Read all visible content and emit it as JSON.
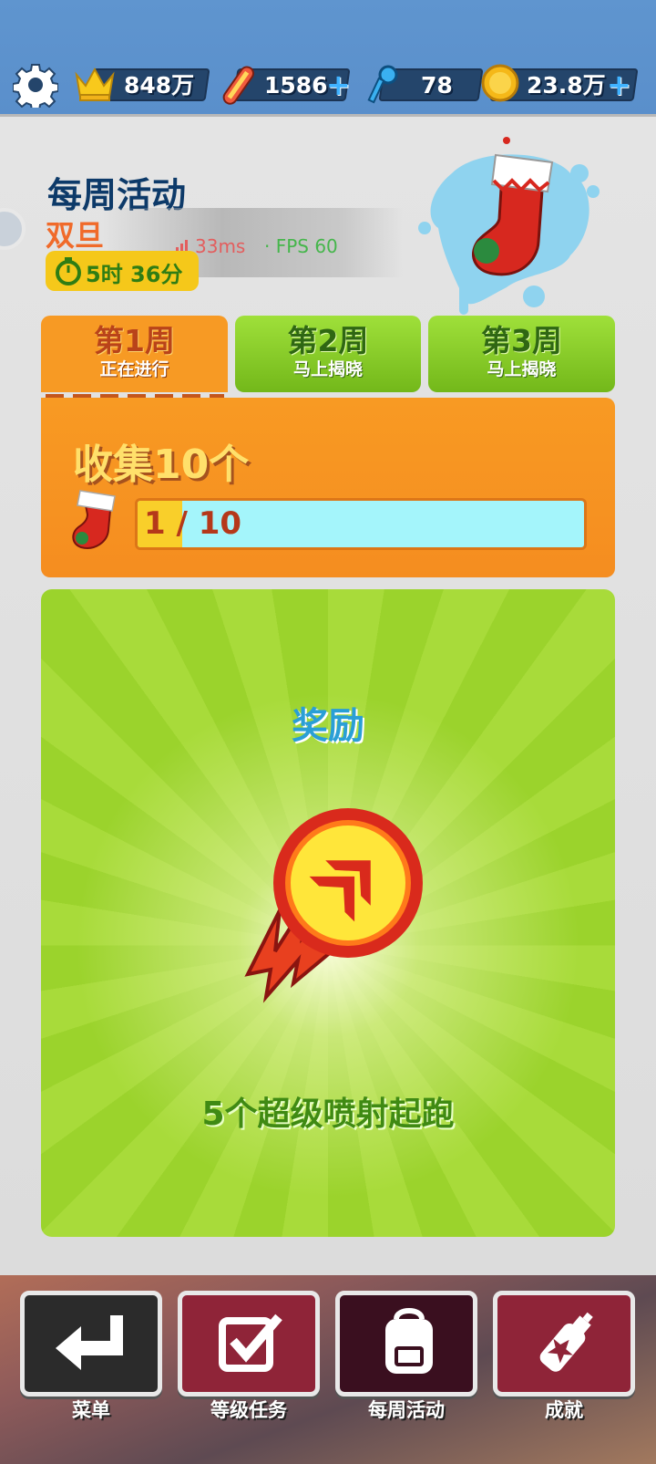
{
  "topbar": {
    "settings_icon": "gear-icon",
    "crowns": "848万",
    "boards": "1586",
    "keys": "78",
    "coins": "23.8万",
    "plus_symbol": "+"
  },
  "event": {
    "title": "每周活动",
    "subtitle": "双旦",
    "timer": "5时 36分"
  },
  "perf_overlay": {
    "latency": "33ms",
    "fps": "· FPS 60"
  },
  "tabs": [
    {
      "title": "第1周",
      "status": "正在进行",
      "active": true
    },
    {
      "title": "第2周",
      "status": "马上揭晓",
      "active": false
    },
    {
      "title": "第3周",
      "status": "马上揭晓",
      "active": false
    }
  ],
  "goal": {
    "title": "收集10个",
    "progress_text": "1 / 10",
    "progress_fraction": 0.1
  },
  "reward": {
    "title": "奖励",
    "description": "5个超级喷射起跑"
  },
  "nav": [
    {
      "label": "菜单",
      "icon": "return-arrow-icon"
    },
    {
      "label": "等级任务",
      "icon": "checkbox-icon"
    },
    {
      "label": "每周活动",
      "icon": "backpack-icon"
    },
    {
      "label": "成就",
      "icon": "spray-can-icon"
    }
  ],
  "colors": {
    "accent_orange": "#f79a24",
    "accent_green": "#8fcf2a",
    "title_navy": "#0d3a69"
  }
}
